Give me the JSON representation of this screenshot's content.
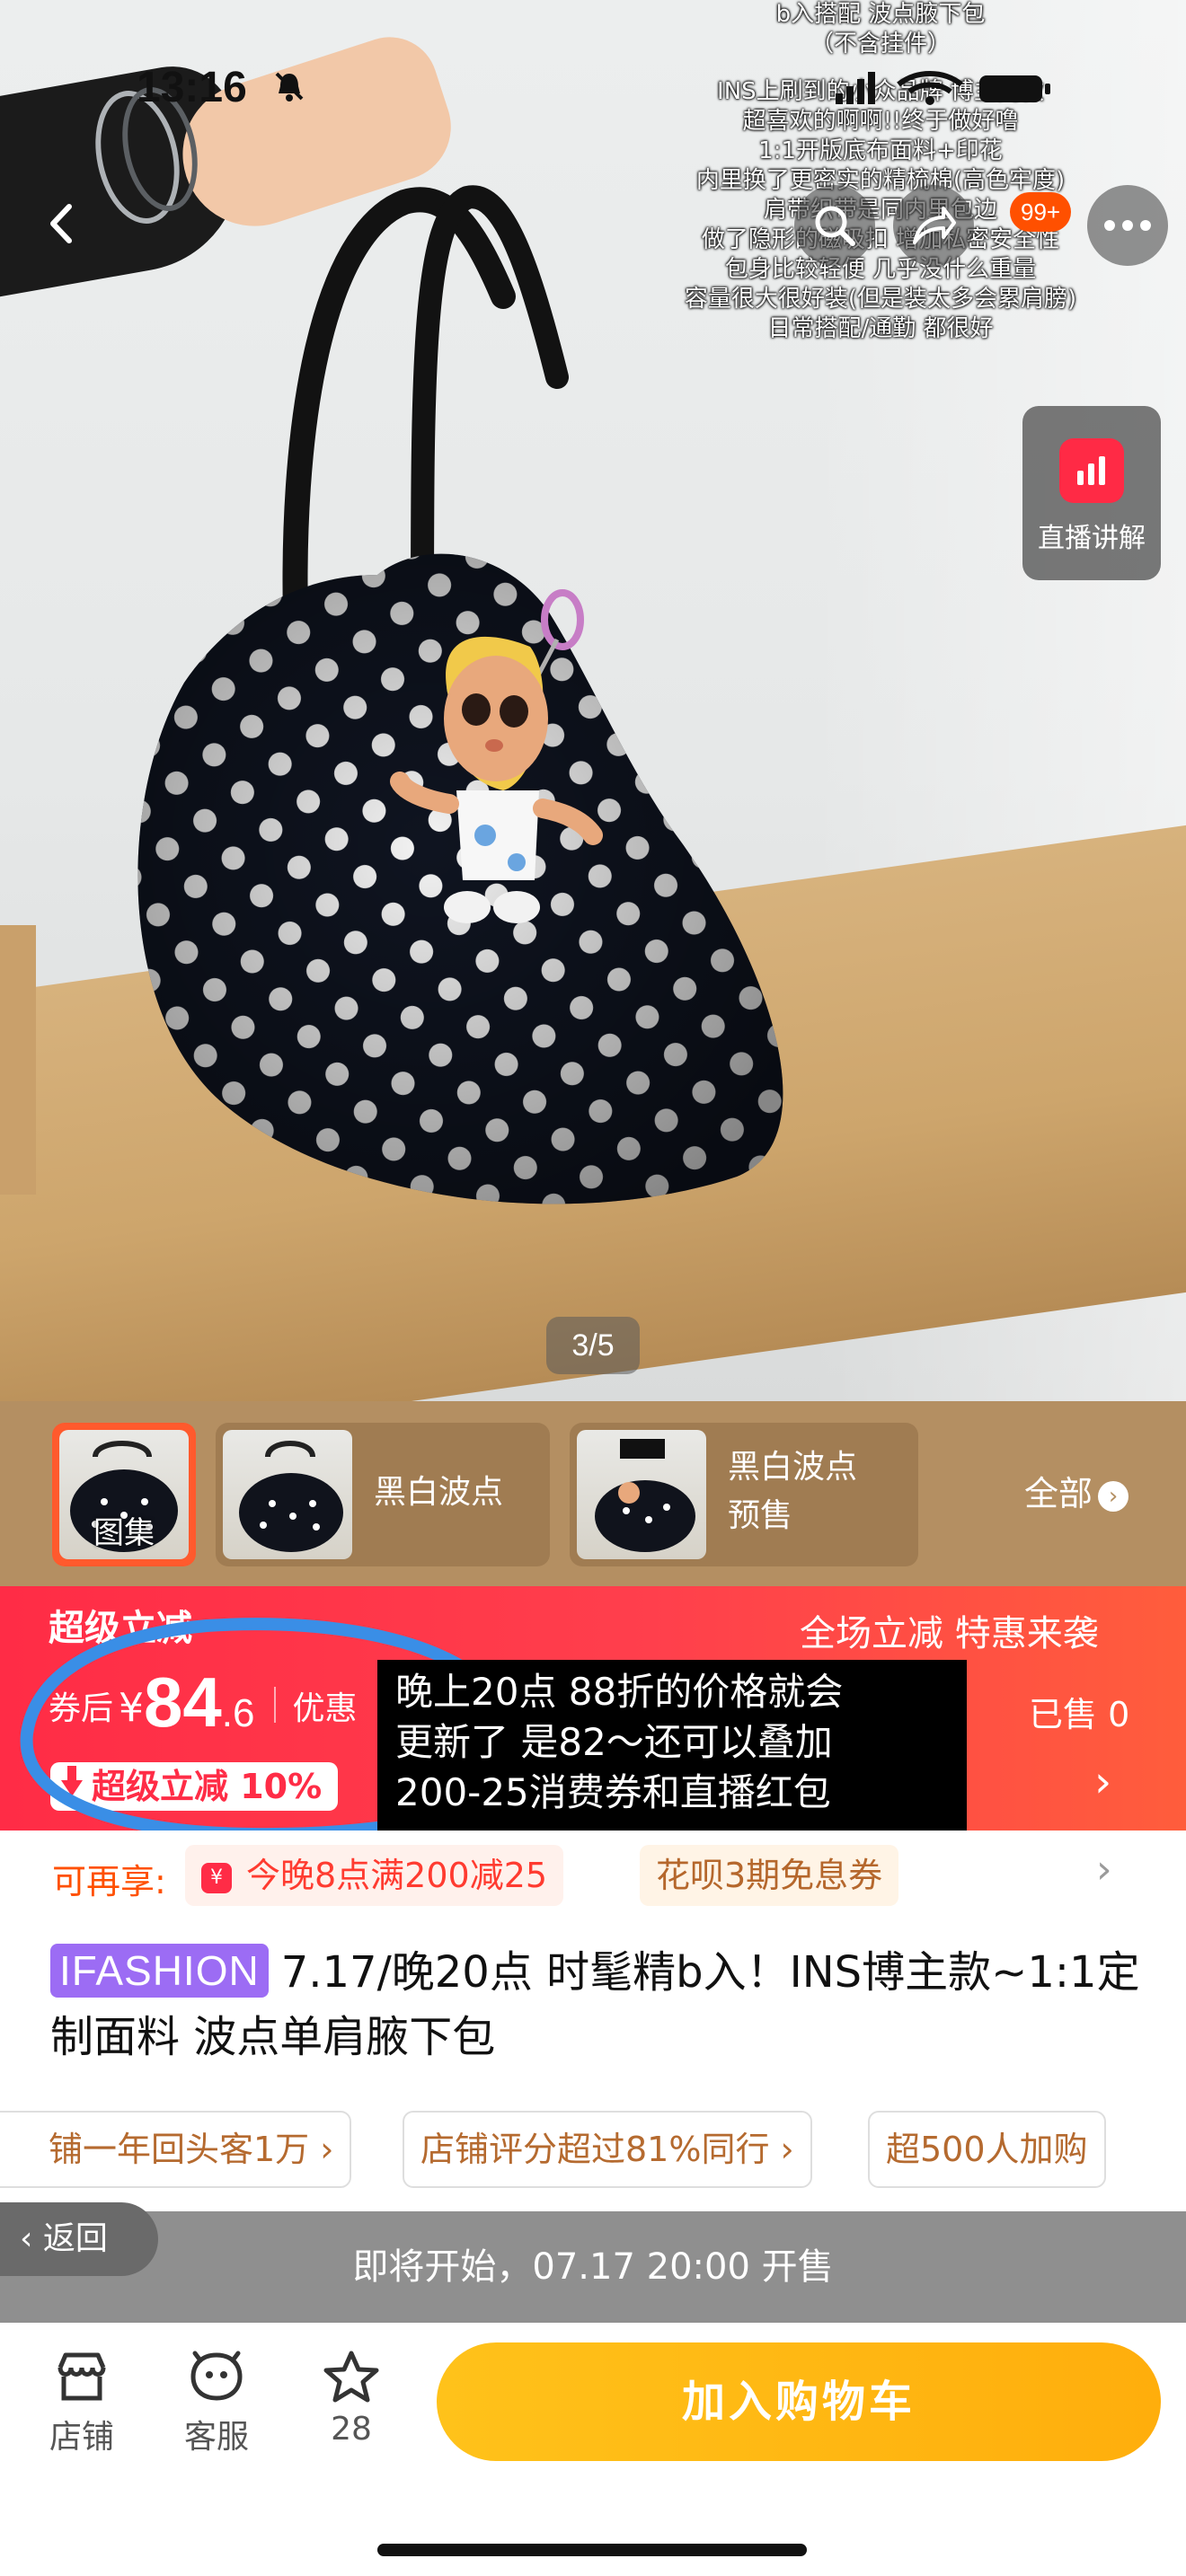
{
  "status_bar": {
    "time": "13:16"
  },
  "hero": {
    "caption_lines": [
      "b入搭配 波点腋下包",
      "（不含挂件）",
      "",
      "INS上刷到的小众品牌 博主同款",
      "超喜欢的啊啊!!终于做好噜",
      "1:1开版底布面料+印花",
      "内里换了更密实的精梳棉(高色牢度)",
      "肩带织带是同内里包边",
      "做了隐形的磁吸扣 增加私密安全性",
      "包身比较轻便 几乎没什么重量",
      "容量很大很好装(但是装太多会累肩膀)",
      "日常搭配/通勤 都很好"
    ],
    "cart_badge": "99+",
    "live_label": "直播讲解",
    "page_indicator": "3/5"
  },
  "thumbs": {
    "gallery_label": "图集",
    "items": [
      {
        "label_lines": [
          "黑白波点"
        ]
      },
      {
        "label_lines": [
          "黑白波点",
          "预售"
        ]
      }
    ],
    "all_label": "全部"
  },
  "promo": {
    "title": "超级立减",
    "right_title": "全场立减 特惠来袭",
    "price_prefix": "券后",
    "price_yen": "¥",
    "price_int": "84",
    "price_dec": ".6",
    "price_tail": "优惠",
    "sold": "已售 0",
    "tag": "超级立减 10%"
  },
  "annotation_lines": [
    "晚上20点 88折的价格就会",
    "更新了 是82～还可以叠加",
    "200-25消费券和直播红包"
  ],
  "coupons": {
    "label": "可再享:",
    "items": [
      "今晚8点满200减25",
      "花呗3期免息券"
    ],
    "icon_glyph": "¥"
  },
  "product": {
    "brand_tag": "IFASHION",
    "title": "7.17/晚20点 时髦精b入！INS博主款~1:1定制面料 波点单肩腋下包"
  },
  "chips": [
    "铺一年回头客1万",
    "店铺评分超过81%同行",
    "超500人加购"
  ],
  "sale_bar": {
    "text": "即将开始，07.17 20:00 开售",
    "back_label": "返回"
  },
  "bottom_bar": {
    "shop": "店铺",
    "service": "客服",
    "favorites": "28",
    "cart_button": "加入购物车"
  },
  "colors": {
    "accent_orange": "#ff5000",
    "promo_red": "#ff2c46",
    "cart_yellow": "#ffb412",
    "brand_purple": "#9c6cf4"
  }
}
